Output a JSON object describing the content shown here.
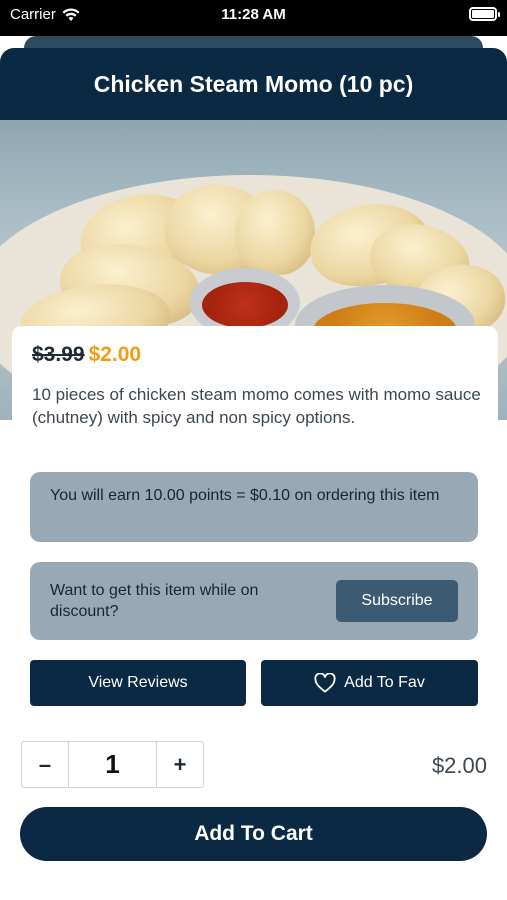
{
  "status_bar": {
    "carrier": "Carrier",
    "time": "11:28 AM"
  },
  "navbar": {
    "title": "Chicken Steam Momo (10 pc)"
  },
  "product": {
    "image_icon": "momo-photo",
    "old_price": "$3.99",
    "new_price": "$2.00",
    "description": "10 pieces of chicken steam momo comes with momo sauce (chutney) with spicy and non spicy options."
  },
  "points_text": "You will earn 10.00 points = $0.10 on ordering this item",
  "subscribe": {
    "text": "Want to get this item while on discount?",
    "button_label": "Subscribe"
  },
  "actions": {
    "reviews_label": "View Reviews",
    "fav_label": "Add To Fav",
    "fav_icon": "heart-icon"
  },
  "cart": {
    "minus_label": "–",
    "quantity": "1",
    "plus_label": "+",
    "total": "$2.00",
    "add_to_cart_label": "Add To Cart"
  },
  "colors": {
    "primary": "#0b2942",
    "accent_price": "#f39c12",
    "info_box": "#98a9b5",
    "subscribe_button": "#3c5a72"
  }
}
